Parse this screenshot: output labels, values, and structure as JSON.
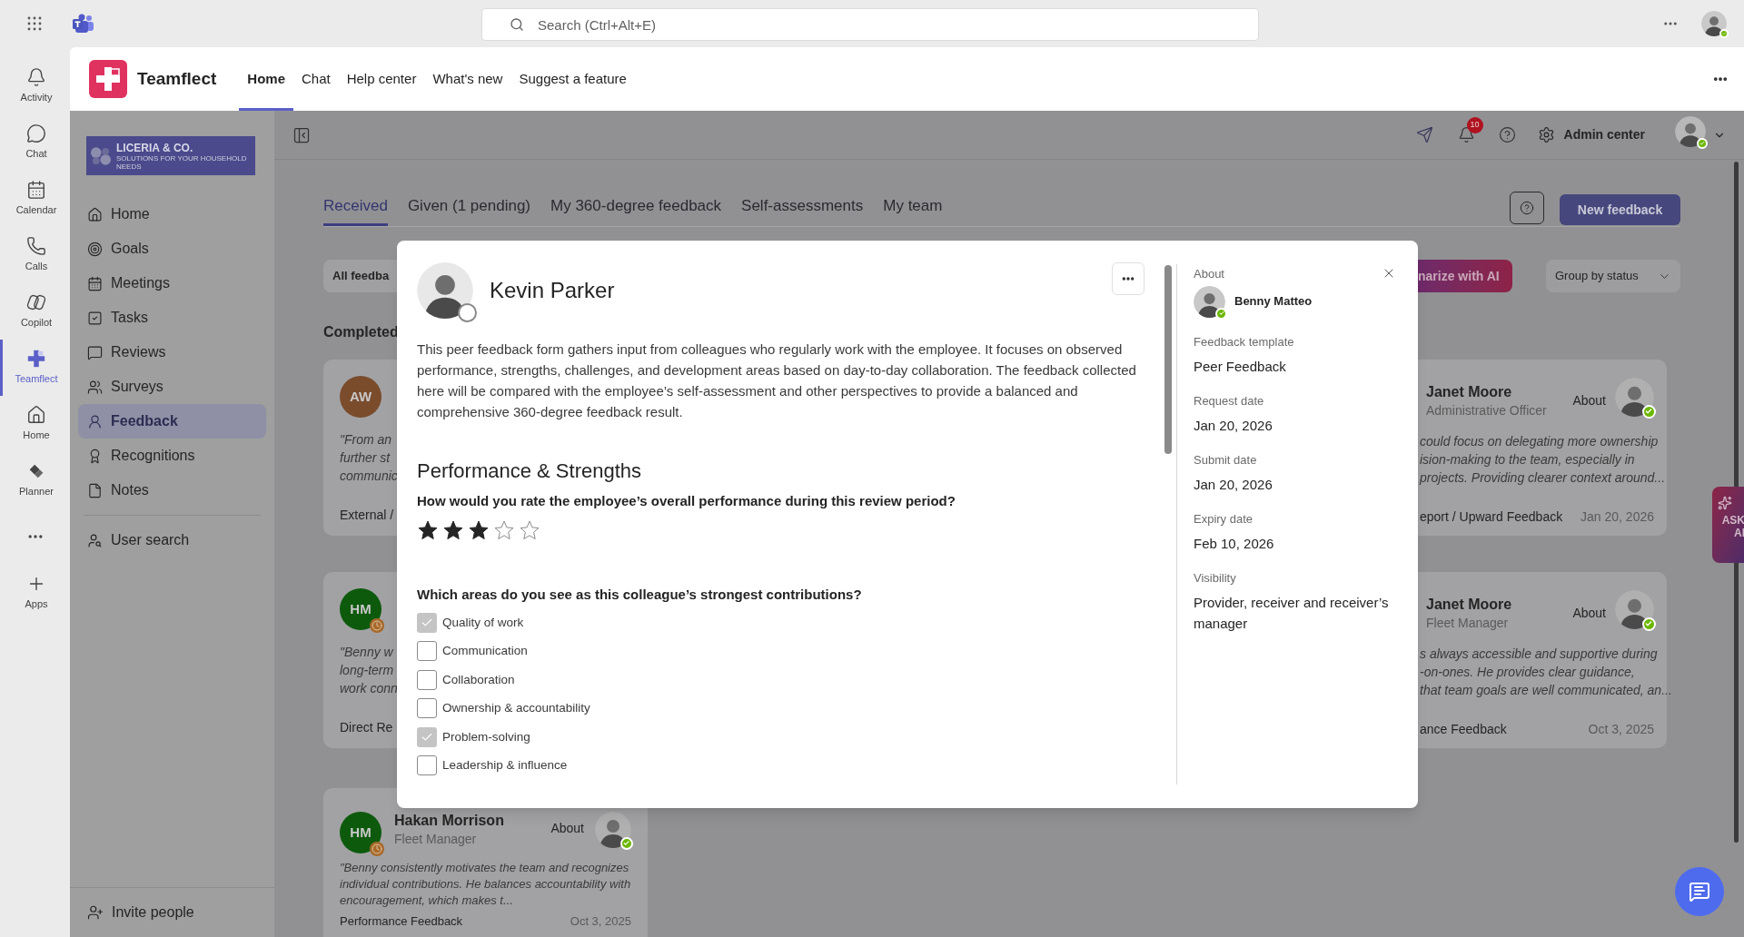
{
  "teams_bar": {
    "search": {
      "placeholder": "Search (Ctrl+Alt+E)"
    }
  },
  "app_rail": [
    {
      "label": "Activity",
      "selected": false
    },
    {
      "label": "Chat",
      "selected": false
    },
    {
      "label": "Calendar",
      "selected": false
    },
    {
      "label": "Calls",
      "selected": false
    },
    {
      "label": "Copilot",
      "selected": false
    },
    {
      "label": "Teamflect",
      "selected": true
    },
    {
      "label": "Home",
      "selected": false
    },
    {
      "label": "Planner",
      "selected": false
    },
    {
      "label": "Apps",
      "selected": false
    }
  ],
  "app_header": {
    "title": "Teamflect",
    "nav": [
      {
        "label": "Home",
        "selected": true
      },
      {
        "label": "Chat",
        "selected": false
      },
      {
        "label": "Help center",
        "selected": false
      },
      {
        "label": "What's new",
        "selected": false
      },
      {
        "label": "Suggest a feature",
        "selected": false
      }
    ]
  },
  "sidebar": {
    "logo": {
      "name": "LICERIA & CO.",
      "tagline": "SOLUTIONS FOR YOUR HOUSEHOLD NEEDS"
    },
    "items": [
      {
        "label": "Home",
        "selected": false
      },
      {
        "label": "Goals",
        "selected": false
      },
      {
        "label": "Meetings",
        "selected": false
      },
      {
        "label": "Tasks",
        "selected": false
      },
      {
        "label": "Reviews",
        "selected": false
      },
      {
        "label": "Surveys",
        "selected": false
      },
      {
        "label": "Feedback",
        "selected": true
      },
      {
        "label": "Recognitions",
        "selected": false
      },
      {
        "label": "Notes",
        "selected": false
      }
    ],
    "secondary": [
      {
        "label": "User search",
        "selected": false
      }
    ],
    "footer": "Invite people"
  },
  "toolbar": {
    "notifications_badge": "10",
    "admin": "Admin center"
  },
  "tabs": [
    {
      "label": "Received",
      "selected": true
    },
    {
      "label": "Given (1 pending)",
      "selected": false
    },
    {
      "label": "My 360-degree feedback",
      "selected": false
    },
    {
      "label": "Self-assessments",
      "selected": false
    },
    {
      "label": "My team",
      "selected": false
    }
  ],
  "new_feedback": "New feedback",
  "filters": {
    "filter": "All feedba",
    "summarize": "narize with AI",
    "group": "Group by status"
  },
  "section": "Completed",
  "left_cards": [
    {
      "initials": "AW",
      "color": "#7a4c2c",
      "pending": false,
      "quote": [
        "\"From an",
        "further st",
        "communic"
      ],
      "footer": "External /"
    },
    {
      "initials": "HM",
      "color": "#0d5a0d",
      "pending": true,
      "quote": [
        "\"Benny w",
        "long-term",
        "work conn"
      ],
      "footer": "Direct Re"
    }
  ],
  "full_card": {
    "initials": "HM",
    "color": "#0d5a0d",
    "pending": true,
    "name": "Hakan Morrison",
    "subtitle": "Fleet Manager",
    "about": "About",
    "quote": "\"Benny consistently motivates the team and recognizes individual contributions. He balances accountability with encouragement, which makes t...",
    "footer": "Performance Feedback",
    "date": "Oct 3, 2025"
  },
  "right_cards": [
    {
      "name": "Janet Moore",
      "subtitle": "Administrative Officer",
      "about": "About",
      "quote": [
        "could focus on delegating more ownership",
        "ision-making to the team, especially in",
        "projects. Providing clearer context around..."
      ],
      "footer": "eport / Upward Feedback",
      "date": "Jan 20, 2026"
    },
    {
      "name": "Janet Moore",
      "subtitle": "Fleet Manager",
      "about": "About",
      "quote": [
        "s always accessible and supportive during",
        "-on-ones. He provides clear guidance,",
        "that team goals are well communicated, an..."
      ],
      "footer": "ance Feedback",
      "date": "Oct 3, 2025"
    }
  ],
  "ask_ai": "ASK AI",
  "modal": {
    "name": "Kevin Parker",
    "description": "This peer feedback form gathers input from colleagues who regularly work with the employee. It focuses on observed performance, strengths, challenges, and development areas based on day-to-day collaboration. The feedback collected here will be compared with the employee’s self-assessment and other perspectives to provide a balanced and comprehensive 360-degree feedback result.",
    "section": "Performance & Strengths",
    "rating_question": "How would you rate the employee’s overall performance during this review period?",
    "stars": 3,
    "checkbox_question": "Which areas do you see as this colleague’s strongest contributions?",
    "options": [
      {
        "label": "Quality of work",
        "checked": true
      },
      {
        "label": "Communication",
        "checked": false
      },
      {
        "label": "Collaboration",
        "checked": false
      },
      {
        "label": "Ownership & accountability",
        "checked": false
      },
      {
        "label": "Problem-solving",
        "checked": true
      },
      {
        "label": "Leadership & influence",
        "checked": false
      }
    ],
    "about": {
      "label": "About",
      "name": "Benny Matteo"
    },
    "details": [
      {
        "label": "Feedback template",
        "value": "Peer Feedback"
      },
      {
        "label": "Request date",
        "value": "Jan 20, 2026"
      },
      {
        "label": "Submit date",
        "value": "Jan 20, 2026"
      },
      {
        "label": "Expiry date",
        "value": "Feb 10, 2026"
      },
      {
        "label": "Visibility",
        "value": "Provider, receiver and receiver’s manager"
      }
    ]
  }
}
